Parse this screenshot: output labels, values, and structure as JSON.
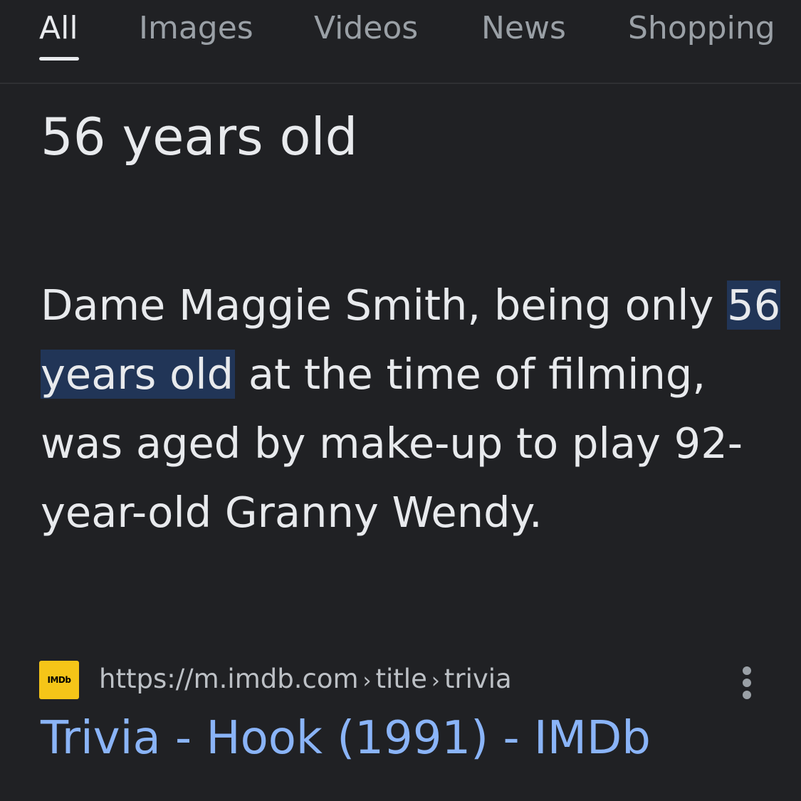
{
  "tabs": [
    {
      "label": "All",
      "active": true
    },
    {
      "label": "Images"
    },
    {
      "label": "Videos"
    },
    {
      "label": "News"
    },
    {
      "label": "Shopping"
    }
  ],
  "answer": "56 years old",
  "snippet": {
    "before": "Dame Maggie Smith, being only ",
    "highlight": "56 years old",
    "after": " at the time of filming, was aged by make-up to play 92-year-old Granny Wendy."
  },
  "result": {
    "favicon_text": "IMDb",
    "url_base": "https://m.imdb.com",
    "url_path": [
      "title",
      "trivia"
    ],
    "title": "Trivia - Hook (1991) - IMDb"
  },
  "colors": {
    "background": "#202124",
    "link": "#8ab4f8",
    "highlight": "#213557",
    "imdb_yellow": "#f5c518"
  },
  "icons": {
    "more": "three-dot-vertical-icon",
    "favicon": "imdb-logo-icon"
  }
}
